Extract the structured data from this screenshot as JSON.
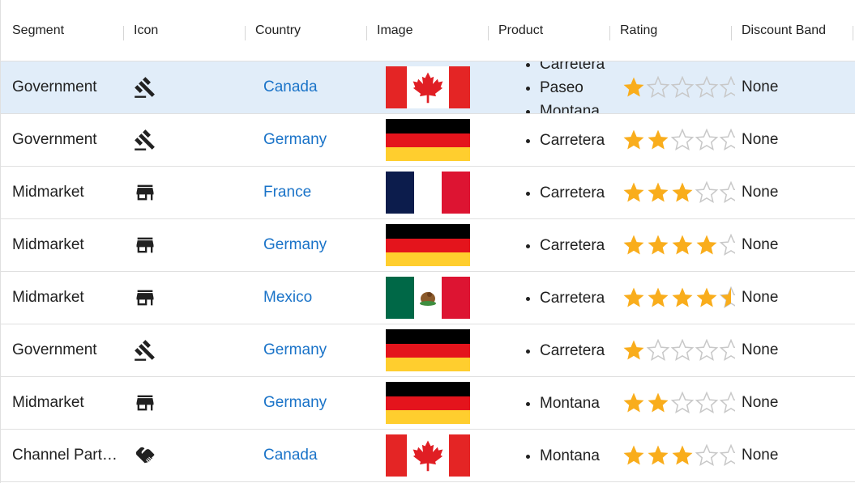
{
  "columns": [
    "Segment",
    "Icon",
    "Country",
    "Image",
    "Product",
    "Rating",
    "Discount Band"
  ],
  "colors": {
    "link": "#1a73c8",
    "selected_row": "#e1edf9",
    "star_filled": "#f9ad1c",
    "star_empty": "#c8c8c8"
  },
  "rows": [
    {
      "segment": "Government",
      "icon": "gavel-icon",
      "country": "Canada",
      "flag": "canada-flag",
      "products": [
        "Carretera",
        "Paseo",
        "Montana"
      ],
      "rating": 1,
      "band": "None",
      "selected": true
    },
    {
      "segment": "Government",
      "icon": "gavel-icon",
      "country": "Germany",
      "flag": "germany-flag",
      "products": [
        "Carretera"
      ],
      "rating": 2,
      "band": "None"
    },
    {
      "segment": "Midmarket",
      "icon": "store-icon",
      "country": "France",
      "flag": "france-flag",
      "products": [
        "Carretera"
      ],
      "rating": 3,
      "band": "None"
    },
    {
      "segment": "Midmarket",
      "icon": "store-icon",
      "country": "Germany",
      "flag": "germany-flag",
      "products": [
        "Carretera"
      ],
      "rating": 4,
      "band": "None"
    },
    {
      "segment": "Midmarket",
      "icon": "store-icon",
      "country": "Mexico",
      "flag": "mexico-flag",
      "products": [
        "Carretera"
      ],
      "rating": 4.5,
      "band": "None"
    },
    {
      "segment": "Government",
      "icon": "gavel-icon",
      "country": "Germany",
      "flag": "germany-flag",
      "products": [
        "Carretera"
      ],
      "rating": 1,
      "band": "None"
    },
    {
      "segment": "Midmarket",
      "icon": "store-icon",
      "country": "Germany",
      "flag": "germany-flag",
      "products": [
        "Montana"
      ],
      "rating": 2,
      "band": "None"
    },
    {
      "segment": "Channel Partners",
      "icon": "handshake-icon",
      "country": "Canada",
      "flag": "canada-flag",
      "products": [
        "Montana"
      ],
      "rating": 3,
      "band": "None"
    }
  ]
}
